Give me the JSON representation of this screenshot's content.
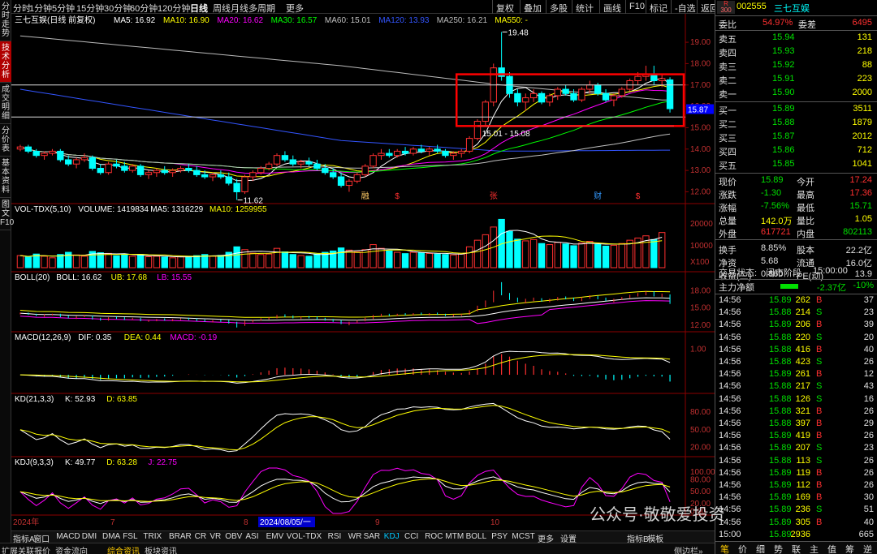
{
  "left_tabs": [
    "分时走势",
    "技术分析",
    "成交明细",
    "分价表",
    "基本资料",
    "图文F10"
  ],
  "toolbar": {
    "periods": [
      "分时",
      "1分钟",
      "5分钟",
      "15分钟",
      "30分钟",
      "60分钟",
      "120分钟",
      "日线",
      "周线",
      "月线",
      "多周期",
      "更多"
    ],
    "active": "日线",
    "right": [
      "复权",
      "叠加",
      "多股",
      "统计",
      "画线",
      "F10",
      "标记",
      "-自选",
      "返回"
    ]
  },
  "chart_data": {
    "type": "candlestick",
    "title": "三七互娱(日线 前复权)",
    "ma_legend": [
      {
        "name": "MA5",
        "value": "16.92",
        "color": "#ffffff"
      },
      {
        "name": "MA10",
        "value": "16.90",
        "color": "#ffff00"
      },
      {
        "name": "MA20",
        "value": "16.62",
        "color": "#ff00ff"
      },
      {
        "name": "MA30",
        "value": "16.57",
        "color": "#00ff00"
      },
      {
        "name": "MA60",
        "value": "15.01",
        "color": "#c0c0c0"
      },
      {
        "name": "MA120",
        "value": "13.93",
        "color": "#3355ff"
      },
      {
        "name": "MA250",
        "value": "16.21",
        "color": "#bbbbbb"
      },
      {
        "name": "MA550",
        "value": "-",
        "color": "#ffff00"
      }
    ],
    "price_axis": [
      19.0,
      18.0,
      17.0,
      16.0,
      15.0,
      14.0,
      13.0,
      12.0
    ],
    "price_axis_labels": [
      "19.00",
      "18.00",
      "17.00",
      "16.00",
      "15.00",
      "14.00",
      "13.00",
      "12.00"
    ],
    "ylim": [
      11.6,
      19.8
    ],
    "current_price_label": "15.87",
    "annotations": {
      "high": "19.48",
      "low": "11.62",
      "range": "15.01 - 15.08"
    },
    "event_marks": [
      "融",
      "$",
      "张",
      "财",
      "$"
    ],
    "x_labels": [
      "2024年",
      "7",
      "8",
      "2024/08/05/一",
      "9",
      "10"
    ],
    "candles": [
      [
        14.0,
        14.2,
        13.9,
        14.1
      ],
      [
        14.1,
        14.2,
        13.8,
        13.9
      ],
      [
        13.9,
        14.0,
        13.6,
        13.7
      ],
      [
        13.7,
        13.9,
        13.5,
        13.8
      ],
      [
        13.8,
        14.0,
        13.7,
        13.9
      ],
      [
        13.9,
        14.0,
        13.4,
        13.5
      ],
      [
        13.5,
        13.7,
        13.2,
        13.3
      ],
      [
        13.3,
        13.6,
        13.1,
        13.5
      ],
      [
        13.5,
        13.8,
        13.4,
        13.6
      ],
      [
        13.6,
        13.7,
        13.0,
        13.1
      ],
      [
        13.1,
        13.3,
        12.8,
        12.9
      ],
      [
        12.9,
        13.4,
        12.8,
        13.3
      ],
      [
        13.3,
        13.5,
        13.1,
        13.2
      ],
      [
        13.2,
        13.4,
        12.9,
        13.0
      ],
      [
        13.0,
        13.3,
        12.9,
        13.2
      ],
      [
        13.2,
        13.3,
        12.7,
        12.8
      ],
      [
        12.8,
        13.0,
        12.6,
        12.9
      ],
      [
        12.9,
        13.1,
        12.7,
        13.0
      ],
      [
        13.0,
        13.2,
        12.8,
        12.9
      ],
      [
        12.9,
        13.1,
        12.7,
        13.0
      ],
      [
        13.0,
        13.2,
        12.9,
        13.1
      ],
      [
        13.1,
        13.3,
        12.9,
        13.0
      ],
      [
        13.0,
        13.2,
        12.7,
        12.8
      ],
      [
        12.8,
        13.0,
        12.6,
        12.7
      ],
      [
        12.7,
        12.9,
        12.5,
        12.8
      ],
      [
        12.8,
        13.0,
        12.6,
        12.7
      ],
      [
        12.7,
        12.9,
        12.3,
        12.4
      ],
      [
        12.4,
        12.6,
        11.62,
        12.0
      ],
      [
        12.0,
        12.8,
        11.9,
        12.7
      ],
      [
        12.7,
        13.0,
        12.5,
        12.9
      ],
      [
        12.9,
        13.2,
        12.8,
        13.1
      ],
      [
        13.1,
        13.4,
        13.0,
        13.3
      ],
      [
        13.3,
        13.8,
        13.2,
        13.7
      ],
      [
        13.7,
        13.9,
        13.4,
        13.5
      ],
      [
        13.5,
        13.7,
        13.2,
        13.3
      ],
      [
        13.3,
        13.5,
        13.1,
        13.4
      ],
      [
        13.4,
        13.6,
        13.2,
        13.3
      ],
      [
        13.3,
        13.5,
        13.0,
        13.1
      ],
      [
        13.1,
        13.3,
        12.8,
        12.9
      ],
      [
        12.9,
        13.1,
        12.6,
        12.7
      ],
      [
        12.7,
        12.9,
        12.2,
        12.3
      ],
      [
        12.3,
        12.6,
        12.0,
        12.5
      ],
      [
        12.5,
        12.9,
        12.4,
        12.8
      ],
      [
        12.8,
        13.3,
        12.7,
        13.2
      ],
      [
        13.2,
        13.8,
        13.1,
        13.7
      ],
      [
        13.7,
        14.0,
        13.5,
        13.8
      ],
      [
        13.8,
        14.0,
        13.6,
        13.7
      ],
      [
        13.7,
        14.0,
        13.6,
        13.9
      ],
      [
        13.9,
        14.1,
        13.7,
        13.8
      ],
      [
        13.8,
        14.1,
        13.7,
        14.0
      ],
      [
        14.0,
        14.2,
        13.8,
        13.9
      ],
      [
        13.9,
        14.1,
        13.7,
        14.0
      ],
      [
        14.0,
        14.2,
        13.8,
        13.9
      ],
      [
        13.9,
        14.0,
        13.6,
        13.7
      ],
      [
        13.7,
        13.9,
        13.5,
        13.8
      ],
      [
        13.8,
        14.0,
        13.6,
        13.9
      ],
      [
        13.9,
        14.6,
        13.8,
        14.5
      ],
      [
        14.5,
        15.4,
        14.4,
        15.3
      ],
      [
        15.3,
        16.3,
        15.1,
        16.2
      ],
      [
        16.2,
        18.0,
        16.0,
        17.8
      ],
      [
        17.8,
        19.48,
        17.2,
        17.4
      ],
      [
        17.4,
        17.6,
        16.4,
        16.6
      ],
      [
        16.6,
        16.8,
        16.0,
        16.2
      ],
      [
        16.2,
        16.6,
        15.8,
        16.4
      ],
      [
        16.4,
        16.8,
        16.2,
        16.6
      ],
      [
        16.6,
        16.7,
        16.1,
        16.2
      ],
      [
        16.2,
        16.6,
        16.0,
        16.5
      ],
      [
        16.5,
        16.9,
        16.3,
        16.8
      ],
      [
        16.8,
        17.0,
        16.5,
        16.6
      ],
      [
        16.6,
        16.8,
        16.2,
        16.3
      ],
      [
        16.3,
        16.9,
        16.2,
        16.8
      ],
      [
        16.8,
        17.2,
        16.6,
        17.0
      ],
      [
        17.0,
        17.1,
        16.5,
        16.6
      ],
      [
        16.6,
        16.8,
        16.2,
        16.3
      ],
      [
        16.3,
        16.6,
        16.0,
        16.5
      ],
      [
        16.5,
        16.9,
        16.4,
        16.8
      ],
      [
        16.8,
        17.3,
        16.7,
        17.2
      ],
      [
        17.2,
        17.6,
        17.0,
        17.4
      ],
      [
        17.4,
        17.9,
        17.2,
        17.5
      ],
      [
        17.5,
        17.9,
        17.0,
        17.2
      ],
      [
        17.2,
        17.5,
        16.9,
        17.3
      ],
      [
        17.24,
        17.36,
        15.71,
        15.89
      ]
    ],
    "volume": {
      "legend": "VOL-TDX(5,10)",
      "volume": "1419834",
      "ma5": "1316229",
      "ma10": "1259955",
      "axis": [
        "20000",
        "10000",
        "X100"
      ],
      "ylim": [
        0,
        24000
      ],
      "values": [
        5500,
        4800,
        6200,
        5200,
        4500,
        6000,
        7000,
        5800,
        5200,
        7400,
        6800,
        6500,
        5400,
        5800,
        5200,
        6000,
        5000,
        5200,
        4800,
        4500,
        5000,
        5200,
        5500,
        6000,
        5200,
        5600,
        7000,
        9500,
        8200,
        6600,
        6000,
        6200,
        8800,
        7200,
        6000,
        5500,
        5200,
        6200,
        7000,
        7600,
        9000,
        8000,
        7200,
        8200,
        10500,
        8800,
        7600,
        7000,
        6400,
        7000,
        6800,
        6500,
        6200,
        6000,
        5800,
        6200,
        9500,
        12500,
        15000,
        18500,
        22000,
        16500,
        13000,
        12200,
        12800,
        11000,
        10500,
        11500,
        10800,
        10000,
        11200,
        12000,
        10600,
        9800,
        10200,
        11000,
        12500,
        13500,
        14500,
        12800,
        16000
      ]
    },
    "boll": {
      "legend": "BOLL(20)",
      "boll": "16.62",
      "ub": "17.68",
      "lb": "15.55",
      "axis": [
        "18.00",
        "15.00",
        "12.00"
      ],
      "ylim": [
        11.3,
        19.6
      ]
    },
    "macd": {
      "legend": "MACD(12,26,9)",
      "dif": "0.35",
      "dea": "0.44",
      "macd": "-0.19",
      "axis": [
        "1.00"
      ],
      "ylim": [
        -0.6,
        1.3
      ]
    },
    "kd": {
      "legend": "KD(21,3,3)",
      "k": "52.93",
      "d": "63.85",
      "axis": [
        "80.00",
        "50.00",
        "20.00"
      ],
      "ylim": [
        10,
        95
      ]
    },
    "kdj": {
      "legend": "KDJ(9,3,3)",
      "k": "49.77",
      "d": "63.28",
      "j": "22.75",
      "axis": [
        "100.00",
        "80.00",
        "50.00",
        "20.00",
        "0.00"
      ],
      "ylim": [
        -5,
        110
      ]
    }
  },
  "bottom_tabs": [
    "指标A",
    "窗口",
    "MACD",
    "DMI",
    "DMA",
    "FSL",
    "TRIX",
    "BRAR",
    "CR",
    "VR",
    "OBV",
    "ASI",
    "EMV",
    "VOL-TDX",
    "RSI",
    "WR",
    "SAR",
    "KDJ",
    "CCI",
    "ROC",
    "MTM",
    "BOLL",
    "PSY",
    "MCST",
    "更多",
    "设置",
    "指标B",
    "模板"
  ],
  "bottom_active": "KDJ",
  "status_tabs": [
    "扩展",
    "关联报价",
    "资金流向",
    "综合资讯",
    "板块资讯"
  ],
  "status_right": "侧边栏»",
  "stock": {
    "code": "002555",
    "name": "三七互娱",
    "badge": "R",
    "badge_sub": "300"
  },
  "order_book": {
    "weibi_label": "委比",
    "weibi": "54.97%",
    "weicha_label": "委差",
    "weicha": "6495",
    "sells": [
      {
        "label": "卖五",
        "price": "15.94",
        "vol": "131"
      },
      {
        "label": "卖四",
        "price": "15.93",
        "vol": "218"
      },
      {
        "label": "卖三",
        "price": "15.92",
        "vol": "88"
      },
      {
        "label": "卖二",
        "price": "15.91",
        "vol": "223"
      },
      {
        "label": "卖一",
        "price": "15.90",
        "vol": "2000"
      }
    ],
    "buys": [
      {
        "label": "买一",
        "price": "15.89",
        "vol": "3511"
      },
      {
        "label": "买二",
        "price": "15.88",
        "vol": "1879"
      },
      {
        "label": "买三",
        "price": "15.87",
        "vol": "2012"
      },
      {
        "label": "买四",
        "price": "15.86",
        "vol": "712"
      },
      {
        "label": "买五",
        "price": "15.85",
        "vol": "1041"
      }
    ]
  },
  "quote": [
    {
      "l1": "现价",
      "v1": "15.89",
      "c1": "green",
      "l2": "今开",
      "v2": "17.24",
      "c2": "red"
    },
    {
      "l1": "涨跌",
      "v1": "-1.30",
      "c1": "green",
      "l2": "最高",
      "v2": "17.36",
      "c2": "red"
    },
    {
      "l1": "涨幅",
      "v1": "-7.56%",
      "c1": "green",
      "l2": "最低",
      "v2": "15.71",
      "c2": "green"
    },
    {
      "l1": "总量",
      "v1": "142.0万",
      "c1": "yellow",
      "l2": "量比",
      "v2": "1.05",
      "c2": "yellow"
    },
    {
      "l1": "外盘",
      "v1": "617721",
      "c1": "red",
      "l2": "内盘",
      "v2": "802113",
      "c2": "green"
    },
    {
      "l1": "换手",
      "v1": "8.85%",
      "c1": "white",
      "l2": "股本",
      "v2": "22.2亿",
      "c2": "white"
    },
    {
      "l1": "净资",
      "v1": "5.68",
      "c1": "white",
      "l2": "流通",
      "v2": "16.0亿",
      "c2": "white"
    },
    {
      "l1": "收益(三)",
      "v1": "0.860",
      "c1": "white",
      "l2": "PE(动)",
      "v2": "13.9",
      "c2": "white"
    }
  ],
  "trade_status": {
    "label": "交易状态:",
    "value": "闭市阶段",
    "time": "15:00:00"
  },
  "main_flow": {
    "label": "主力净额",
    "value": "-2.37亿",
    "pct": "-10%"
  },
  "ticks": [
    [
      "14:56",
      "15.89",
      "262",
      "B",
      "37"
    ],
    [
      "14:56",
      "15.88",
      "214",
      "S",
      "23"
    ],
    [
      "14:56",
      "15.89",
      "206",
      "B",
      "39"
    ],
    [
      "14:56",
      "15.88",
      "220",
      "S",
      "20"
    ],
    [
      "14:56",
      "15.88",
      "416",
      "B",
      "40"
    ],
    [
      "14:56",
      "15.88",
      "423",
      "S",
      "26"
    ],
    [
      "14:56",
      "15.89",
      "261",
      "B",
      "12"
    ],
    [
      "14:56",
      "15.88",
      "217",
      "S",
      "43"
    ],
    [
      "14:56",
      "15.88",
      "126",
      "S",
      "16"
    ],
    [
      "14:56",
      "15.88",
      "321",
      "B",
      "26"
    ],
    [
      "14:56",
      "15.88",
      "397",
      "B",
      "29"
    ],
    [
      "14:56",
      "15.89",
      "419",
      "B",
      "26"
    ],
    [
      "14:56",
      "15.89",
      "207",
      "S",
      "23"
    ],
    [
      "14:56",
      "15.88",
      "113",
      "S",
      "26"
    ],
    [
      "14:56",
      "15.89",
      "119",
      "B",
      "26"
    ],
    [
      "14:56",
      "15.89",
      "112",
      "B",
      "26"
    ],
    [
      "14:56",
      "15.89",
      "169",
      "B",
      "30"
    ],
    [
      "14:56",
      "15.89",
      "236",
      "S",
      "51"
    ],
    [
      "14:56",
      "15.89",
      "305",
      "B",
      "40"
    ],
    [
      "15:00",
      "15.89",
      "2936",
      "",
      "665"
    ]
  ],
  "right_tabs": [
    "笔",
    "价",
    "细",
    "势",
    "联",
    "主",
    "值",
    "筹",
    "逆"
  ],
  "watermark": "公众号·敬敬爱投资"
}
